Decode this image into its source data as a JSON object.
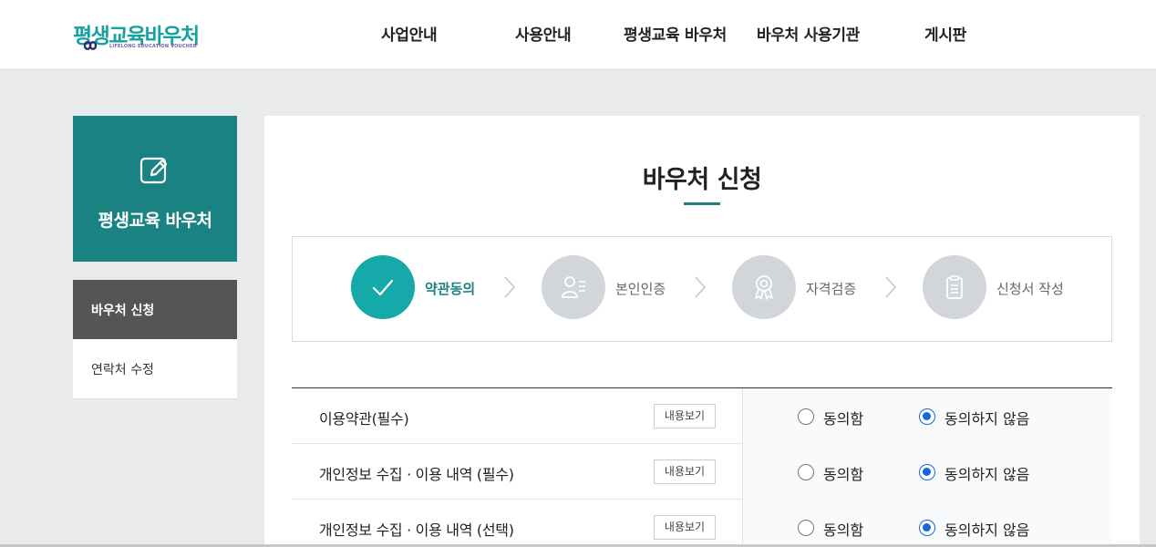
{
  "header": {
    "logo_text": "평생교육바우처",
    "logo_subtext": "LIFELONG EDUCATION VOUCHER",
    "nav": [
      "사업안내",
      "사용안내",
      "평생교육 바우처",
      "바우처 사용기관",
      "게시판"
    ]
  },
  "sidebar": {
    "hero_title": "평생교육 바우처",
    "hero_icon": "edit-icon",
    "items": [
      {
        "label": "바우처 신청",
        "active": true
      },
      {
        "label": "연락처 수정",
        "active": false
      }
    ]
  },
  "main": {
    "title": "바우처 신청",
    "steps": [
      {
        "label": "약관동의",
        "icon": "check-icon",
        "active": true
      },
      {
        "label": "본인인증",
        "icon": "person-id-icon",
        "active": false
      },
      {
        "label": "자격검증",
        "icon": "award-icon",
        "active": false
      },
      {
        "label": "신청서 작성",
        "icon": "document-icon",
        "active": false
      }
    ],
    "terms": [
      {
        "title": "이용약관(필수)",
        "view_label": "내용보기",
        "agree_label": "동의함",
        "disagree_label": "동의하지 않음",
        "selected": "disagree"
      },
      {
        "title": "개인정보 수집 · 이용 내역 (필수)",
        "view_label": "내용보기",
        "agree_label": "동의함",
        "disagree_label": "동의하지 않음",
        "selected": "disagree"
      },
      {
        "title": "개인정보 수집 · 이용 내역 (선택)",
        "view_label": "내용보기",
        "agree_label": "동의함",
        "disagree_label": "동의하지 않음",
        "selected": "disagree"
      }
    ]
  },
  "colors": {
    "brand": "#1b8283",
    "step_active": "#16a9aa",
    "step_inactive": "#d2d6da",
    "radio_checked": "#1a66d9"
  }
}
